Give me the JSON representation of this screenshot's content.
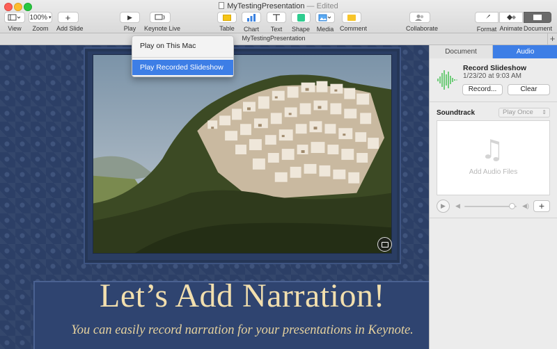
{
  "window": {
    "title": "MyTestingPresentation",
    "status": "— Edited"
  },
  "toolbar": {
    "view": "View",
    "zoom_value": "100%",
    "zoom": "Zoom",
    "add_slide": "Add Slide",
    "play": "Play",
    "keynote_live": "Keynote Live",
    "table": "Table",
    "chart": "Chart",
    "text": "Text",
    "shape": "Shape",
    "media": "Media",
    "comment": "Comment",
    "collaborate": "Collaborate",
    "format": "Format",
    "animate": "Animate",
    "document": "Document"
  },
  "tab": {
    "name": "MyTestingPresentation",
    "add": "+"
  },
  "play_menu": {
    "items": [
      {
        "label": "Play on This Mac",
        "selected": false
      },
      {
        "label": "Play Recorded Slideshow",
        "selected": true
      }
    ]
  },
  "slide": {
    "title": "Let’s Add Narration!",
    "subtitle": "You can easily record narration for your presentations in Keynote."
  },
  "inspector": {
    "tabs": [
      {
        "label": "Document",
        "active": false
      },
      {
        "label": "Audio",
        "active": true
      }
    ],
    "record": {
      "title": "Record Slideshow",
      "date": "1/23/20 at 9:03 AM",
      "record_button": "Record...",
      "clear_button": "Clear"
    },
    "soundtrack": {
      "label": "Soundtrack",
      "mode": "Play Once",
      "dropzone_text": "Add Audio Files",
      "volume_level": 0.92
    }
  },
  "colors": {
    "accent": "#3d7ee6",
    "slide_bg": "#2c3f66",
    "title_text": "#f2dfae"
  }
}
